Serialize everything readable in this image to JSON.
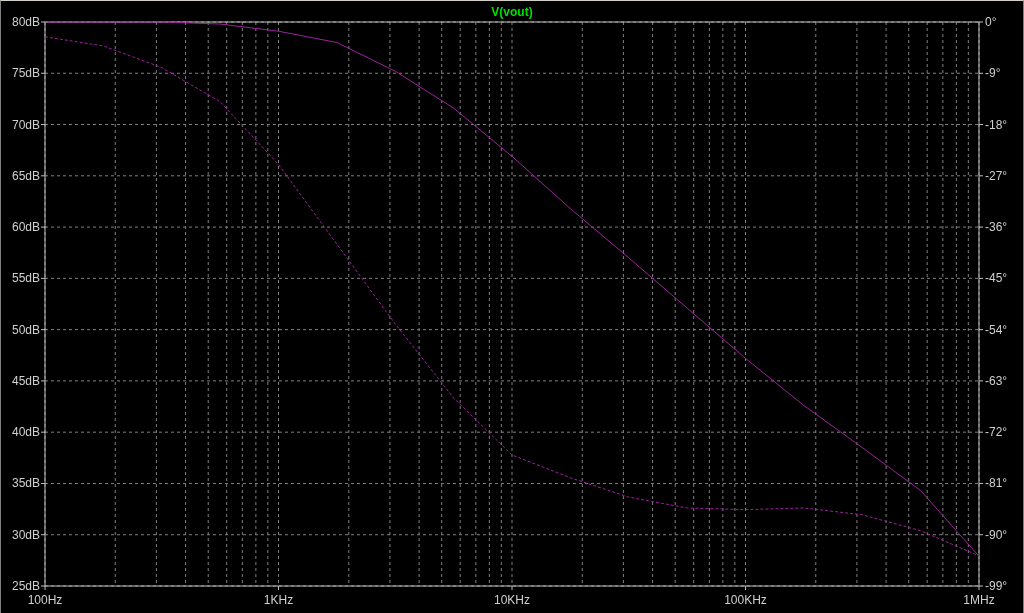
{
  "plot": {
    "chart_data": {
      "type": "line",
      "title": "V(vout)",
      "grid": true,
      "categories": [
        "100Hz",
        null,
        null,
        null,
        "1KHz",
        null,
        null,
        null,
        "10KHz",
        null,
        null,
        null,
        "100KHz",
        null,
        null,
        null,
        "1MHz"
      ],
      "ylim": [
        25,
        80
      ],
      "yticks": [
        {
          "value": 80,
          "label": "80dB"
        },
        {
          "value": 75,
          "label": "75dB"
        },
        {
          "value": 70,
          "label": "70dB"
        },
        {
          "value": 65,
          "label": "65dB"
        },
        {
          "value": 60,
          "label": "60dB"
        },
        {
          "value": 55,
          "label": "55dB"
        },
        {
          "value": 50,
          "label": "50dB"
        },
        {
          "value": 45,
          "label": "45dB"
        },
        {
          "value": 40,
          "label": "40dB"
        },
        {
          "value": 35,
          "label": "35dB"
        },
        {
          "value": 30,
          "label": "30dB"
        },
        {
          "value": 25,
          "label": "25dB"
        }
      ],
      "y2lim": [
        -99,
        0
      ],
      "y2ticks": [
        {
          "value": 0,
          "label": "0°"
        },
        {
          "value": -9,
          "label": "-9°"
        },
        {
          "value": -18,
          "label": "-18°"
        },
        {
          "value": -27,
          "label": "-27°"
        },
        {
          "value": -36,
          "label": "-36°"
        },
        {
          "value": -45,
          "label": "-45°"
        },
        {
          "value": -54,
          "label": "-54°"
        },
        {
          "value": -63,
          "label": "-63°"
        },
        {
          "value": -72,
          "label": "-72°"
        },
        {
          "value": -81,
          "label": "-81°"
        },
        {
          "value": -90,
          "label": "-90°"
        },
        {
          "value": -99,
          "label": "-99°"
        }
      ],
      "series": [
        {
          "color": "#a020a0",
          "line_style": "solid",
          "values": [
            80,
            80,
            80,
            79.8,
            79.1,
            78,
            75.2,
            71.6,
            66.9,
            61.8,
            57,
            52.1,
            47.2,
            42.6,
            38.5,
            34.3,
            27.9
          ]
        },
        {
          "axis": "y2",
          "color": "#a020a0",
          "line_style": "dashed",
          "values": [
            -2.6,
            -4.2,
            -8,
            -14,
            -25,
            -39,
            -53,
            -66,
            -76,
            -80,
            -83.4,
            -85.3,
            -85.6,
            -85.3,
            -86.5,
            -89.3,
            -93.7
          ]
        }
      ]
    }
  }
}
